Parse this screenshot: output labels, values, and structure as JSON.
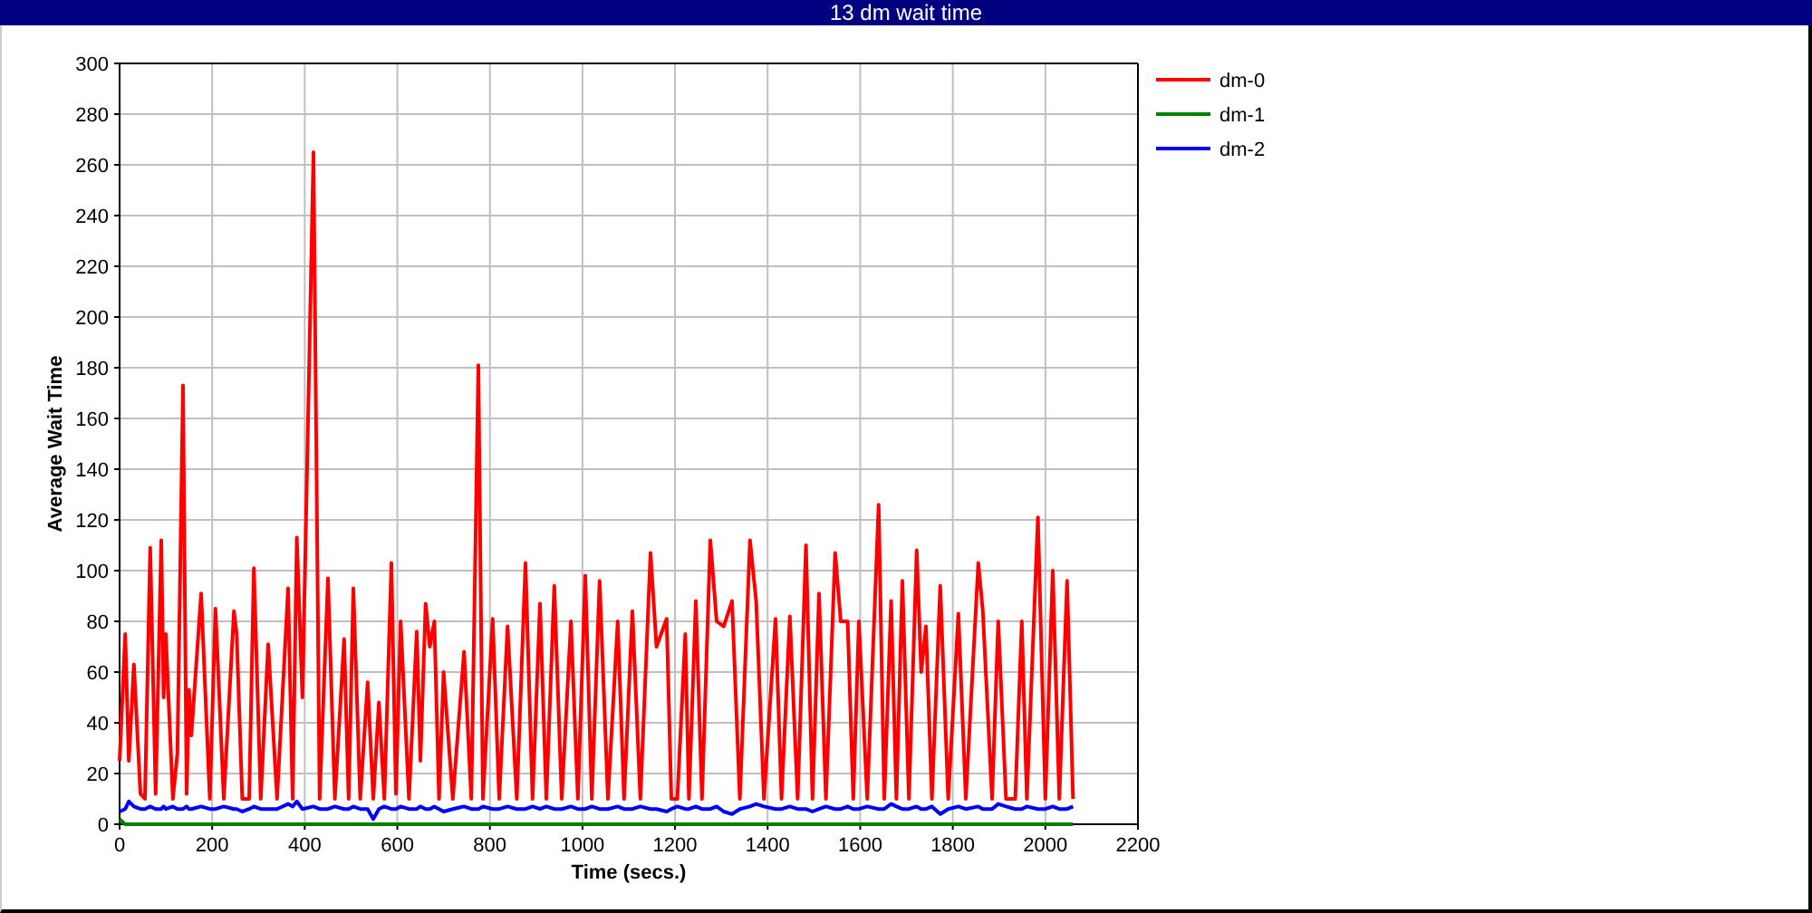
{
  "window": {
    "title": "13 dm wait time"
  },
  "chart": {
    "chart_data": {
      "type": "line",
      "grid": true,
      "legend": true,
      "xlabel": "Time (secs.)",
      "ylabel": "Average Wait Time",
      "x": [
        0,
        12,
        20,
        31,
        45,
        55,
        66,
        78,
        90,
        95,
        100,
        115,
        125,
        137,
        145,
        150,
        155,
        176,
        195,
        207,
        225,
        247,
        253,
        265,
        280,
        290,
        305,
        321,
        340,
        364,
        374,
        383,
        395,
        419,
        432,
        450,
        465,
        485,
        495,
        505,
        520,
        536,
        548,
        560,
        572,
        587,
        597,
        607,
        625,
        642,
        650,
        661,
        670,
        680,
        690,
        700,
        720,
        744,
        760,
        775,
        785,
        806,
        820,
        838,
        858,
        877,
        892,
        908,
        922,
        939,
        955,
        975,
        990,
        1006,
        1020,
        1037,
        1055,
        1076,
        1090,
        1108,
        1125,
        1147,
        1160,
        1182,
        1192,
        1205,
        1222,
        1230,
        1245,
        1258,
        1276,
        1290,
        1305,
        1323,
        1340,
        1362,
        1375,
        1392,
        1417,
        1430,
        1448,
        1465,
        1483,
        1497,
        1511,
        1526,
        1546,
        1558,
        1573,
        1585,
        1597,
        1615,
        1640,
        1652,
        1667,
        1678,
        1691,
        1705,
        1722,
        1732,
        1742,
        1755,
        1773,
        1790,
        1812,
        1828,
        1855,
        1865,
        1885,
        1898,
        1915,
        1935,
        1949,
        1960,
        1984,
        2000,
        2016,
        2030,
        2047,
        2060
      ],
      "series": [
        {
          "name": "dm-0",
          "color": "#ff0000",
          "values": [
            25,
            75,
            25,
            63,
            12,
            10,
            109,
            12,
            112,
            50,
            75,
            10,
            28,
            173,
            12,
            53,
            35,
            91,
            10,
            85,
            10,
            84,
            75,
            10,
            10,
            101,
            10,
            71,
            10,
            93,
            10,
            113,
            50,
            265,
            10,
            97,
            10,
            73,
            10,
            93,
            10,
            56,
            10,
            48,
            10,
            103,
            12,
            80,
            10,
            76,
            25,
            87,
            70,
            80,
            10,
            60,
            10,
            68,
            10,
            181,
            10,
            81,
            10,
            78,
            10,
            103,
            10,
            87,
            10,
            94,
            10,
            80,
            10,
            98,
            10,
            96,
            10,
            80,
            10,
            84,
            10,
            107,
            70,
            81,
            10,
            10,
            75,
            10,
            88,
            10,
            112,
            80,
            78,
            88,
            10,
            112,
            88,
            10,
            81,
            10,
            82,
            10,
            110,
            10,
            91,
            10,
            107,
            80,
            80,
            10,
            80,
            10,
            126,
            10,
            88,
            10,
            96,
            10,
            108,
            60,
            78,
            10,
            94,
            10,
            83,
            10,
            103,
            84,
            10,
            80,
            10,
            10,
            80,
            10,
            121,
            10,
            100,
            10,
            96,
            10
          ]
        },
        {
          "name": "dm-1",
          "color": "#008000",
          "values": [
            2,
            0,
            0,
            0,
            0,
            0,
            0,
            0,
            0,
            0,
            0,
            0,
            0,
            0,
            0,
            0,
            0,
            0,
            0,
            0,
            0,
            0,
            0,
            0,
            0,
            0,
            0,
            0,
            0,
            0,
            0,
            0,
            0,
            0,
            0,
            0,
            0,
            0,
            0,
            0,
            0,
            0,
            0,
            0,
            0,
            0,
            0,
            0,
            0,
            0,
            0,
            0,
            0,
            0,
            0,
            0,
            0,
            0,
            0,
            0,
            0,
            0,
            0,
            0,
            0,
            0,
            0,
            0,
            0,
            0,
            0,
            0,
            0,
            0,
            0,
            0,
            0,
            0,
            0,
            0,
            0,
            0,
            0,
            0,
            0,
            0,
            0,
            0,
            0,
            0,
            0,
            0,
            0,
            0,
            0,
            0,
            0,
            0,
            0,
            0,
            0,
            0,
            0,
            0,
            0,
            0,
            0,
            0,
            0,
            0,
            0,
            0,
            0,
            0,
            0,
            0,
            0,
            0,
            0,
            0,
            0,
            0,
            0,
            0,
            0,
            0,
            0,
            0,
            0,
            0,
            0,
            0,
            0,
            0,
            0,
            0,
            0,
            0,
            0,
            0
          ]
        },
        {
          "name": "dm-2",
          "color": "#0000ff",
          "values": [
            5,
            6,
            9,
            7,
            6,
            6,
            7,
            6,
            6,
            7,
            6,
            7,
            6,
            6,
            7,
            6,
            6,
            7,
            6,
            6,
            7,
            6,
            6,
            5,
            6,
            7,
            6,
            6,
            6,
            8,
            7,
            9,
            6,
            7,
            6,
            6,
            7,
            6,
            6,
            7,
            6,
            6,
            2,
            6,
            7,
            6,
            6,
            7,
            6,
            6,
            7,
            6,
            6,
            7,
            6,
            5,
            6,
            7,
            6,
            6,
            7,
            6,
            6,
            7,
            6,
            6,
            7,
            6,
            7,
            6,
            6,
            7,
            6,
            6,
            7,
            6,
            6,
            7,
            6,
            6,
            7,
            6,
            6,
            5,
            6,
            7,
            6,
            6,
            7,
            6,
            6,
            7,
            5,
            4,
            6,
            7,
            8,
            7,
            6,
            6,
            7,
            6,
            6,
            5,
            6,
            7,
            6,
            6,
            7,
            6,
            6,
            7,
            6,
            6,
            8,
            7,
            6,
            6,
            7,
            6,
            6,
            7,
            4,
            6,
            7,
            6,
            7,
            6,
            6,
            8,
            7,
            6,
            6,
            7,
            6,
            6,
            7,
            6,
            6,
            7
          ]
        }
      ],
      "xlim": [
        0,
        2200
      ],
      "ylim": [
        0,
        300
      ],
      "xticks": [
        0,
        200,
        400,
        600,
        800,
        1000,
        1200,
        1400,
        1600,
        1800,
        2000,
        2200
      ],
      "yticks": [
        0,
        20,
        40,
        60,
        80,
        100,
        120,
        140,
        160,
        180,
        200,
        220,
        240,
        260,
        280,
        300
      ]
    }
  }
}
